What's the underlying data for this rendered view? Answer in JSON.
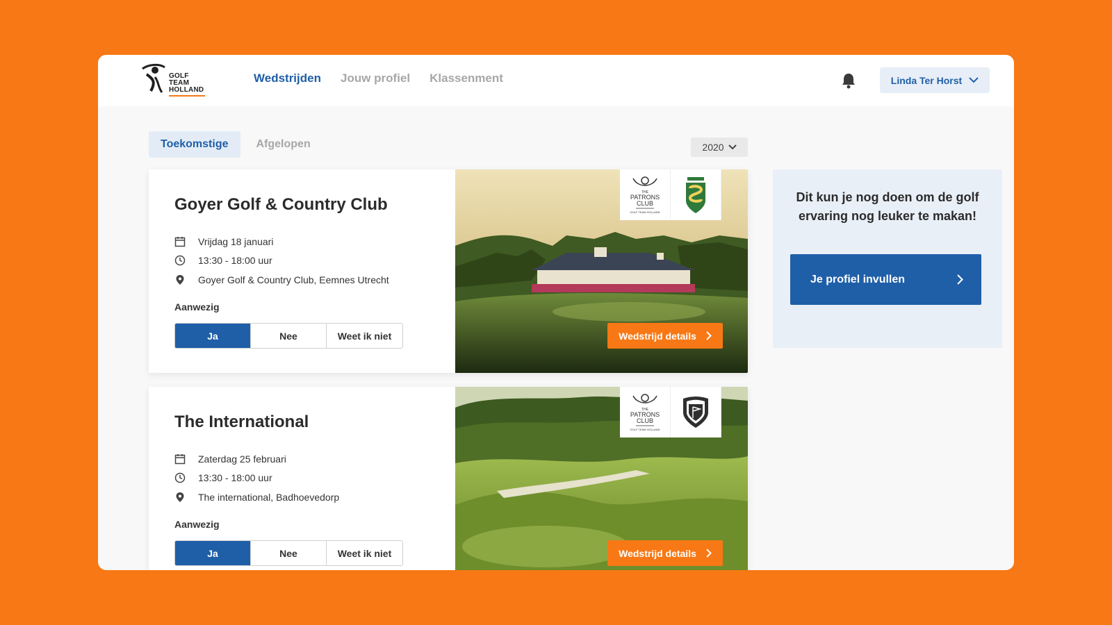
{
  "brand": {
    "logo_lines": [
      "GOLF",
      "TEAM",
      "HOLLAND"
    ],
    "accent": "#F77814",
    "primary": "#1F5FA8"
  },
  "nav": {
    "items": [
      {
        "label": "Wedstrijden",
        "active": true
      },
      {
        "label": "Jouw profiel",
        "active": false
      },
      {
        "label": "Klassenment",
        "active": false
      }
    ]
  },
  "header": {
    "user_name": "Linda Ter Horst",
    "bell_icon": "bell-icon"
  },
  "tabs": [
    {
      "label": "Toekomstige",
      "active": true
    },
    {
      "label": "Afgelopen",
      "active": false
    }
  ],
  "year_filter": {
    "value": "2020"
  },
  "matches": [
    {
      "title": "Goyer Golf & Country Club",
      "date": "Vrijdag 18 januari",
      "time": "13:30 - 18:00 uur",
      "location": "Goyer Golf & Country Club, Eemnes Utrecht",
      "attendance_label": "Aanwezig",
      "options": [
        "Ja",
        "Nee",
        "Weet ik niet"
      ],
      "selected": "Ja",
      "details_label": "Wedstrijd details",
      "logos": [
        "The Patrons Club",
        "Goyer Golfclub"
      ]
    },
    {
      "title": "The International",
      "date": "Zaterdag 25 februari",
      "time": "13:30 - 18:00 uur",
      "location": "The international, Badhoevedorp",
      "attendance_label": "Aanwezig",
      "options": [
        "Ja",
        "Nee",
        "Weet ik niet"
      ],
      "selected": "Ja",
      "details_label": "Wedstrijd details",
      "logos": [
        "The Patrons Club",
        "The International"
      ]
    }
  ],
  "sidebar": {
    "text": "Dit kun je nog doen om de golf ervaring nog leuker te makan!",
    "cta_label": "Je profiel invullen"
  },
  "patrons_logo_text": {
    "top": "THE",
    "mid": "PATRONS",
    "bot": "CLUB",
    "sub": "GOLF TEAM HOLLAND"
  }
}
